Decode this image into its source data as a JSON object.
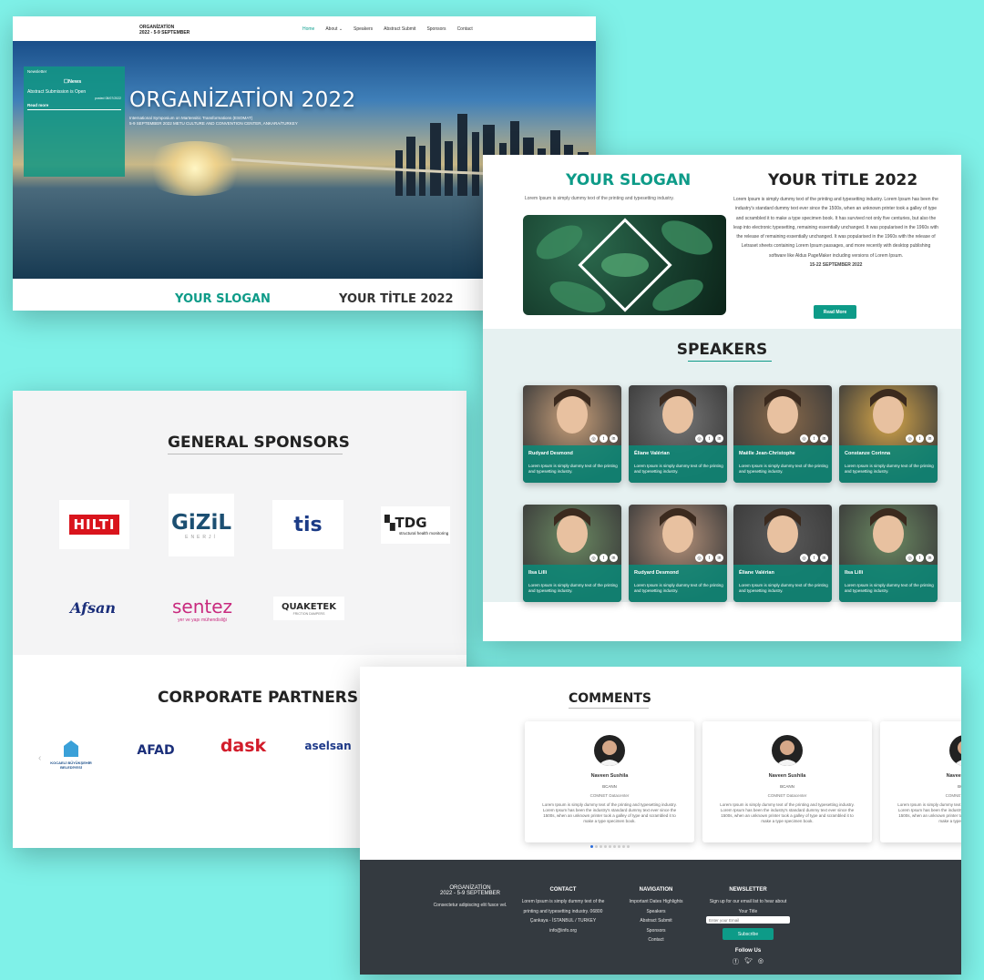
{
  "hero": {
    "brand_line1": "ORGANİZATİON",
    "brand_line2": "2022 - 5-9 SEPTEMBER",
    "nav": [
      "Home",
      "About",
      "Speakers",
      "Abstract Submit",
      "Sponsors",
      "Contact"
    ],
    "news_head": "Newsletter",
    "news_title": "News",
    "news_item": "Abstract Submission is Open",
    "news_date": "posted 08/07/2022",
    "news_more": "Read more",
    "title": "ORGANİZATİON 2022",
    "sub1": "International Symposium on Martensitic Transformations (ESOMAT)",
    "sub2": "5-9 SEPTEMBER 2022 METU CULTURE AND CONVENTION CENTER, ANKARA/TURKEY",
    "band_slogan": "YOUR SLOGAN",
    "band_title": "YOUR TİTLE 2022"
  },
  "about": {
    "slogan": "YOUR SLOGAN",
    "slogan_text": "Lorem Ipsum is simply dummy text of the printing and typesetting industry.",
    "title": "YOUR TİTLE 2022",
    "body": "Lorem Ipsum is simply dummy text of the printing and typesetting industry. Lorem Ipsum has been the industry's standard dummy text ever since the 1500s, when an unknown printer took a galley of type and scrambled it to make a type specimen book. It has survived not only five centuries, but also the leap into electronic typesetting, remaining essentially unchanged. It was popularised in the 1960s with the release of remaining essentially unchanged. It was popularised in the 1960s with the release of Letraset sheets containing Lorem Ipsum passages, and more recently with desktop publishing software like Aldus PageMaker including versions of Lorem Ipsum.",
    "dates": "15-22 SEPTEMBER 2022",
    "read_more": "Read More"
  },
  "speakers": {
    "title": "SPEAKERS",
    "desc": "Lorem Ipsum is simply dummy text of the printing and typesetting industry.",
    "names": [
      "Rudyard Desmond",
      "Éliane Valérian",
      "Maëlle Jean-Christophe",
      "Constanze Corinna",
      "Ilsa Lilli",
      "Rudyard Desmond",
      "Éliane Valérian",
      "Ilsa Lilli"
    ]
  },
  "sponsors": {
    "title": "GENERAL SPONSORS",
    "logos": [
      "HILTI",
      "GiZiL",
      "ENERJİ",
      "tis",
      "TDG",
      "structural health monitoring",
      "Afsan",
      "sentez",
      "yer ve yapı mühendisliği",
      "QUAKETEK",
      "FRICTION DAMPERS"
    ],
    "partners_title": "CORPORATE PARTNERS",
    "partners": [
      "KOCAELİ BÜYÜKŞEHİR BELEDİYESİ",
      "AFAD",
      "dask",
      "aselsan"
    ]
  },
  "comments": {
    "title": "COMMENTS",
    "name": "Naveen Sushila",
    "org": "BCANN",
    "dept": "COMNET Datacenter",
    "text": "Lorem Ipsum is simply dummy text of the printing and typesetting industry. Lorem Ipsum has been the industry's standard dummy text ever since the 1500s, when an unknown printer took a galley of type and scrambled it to make a type specimen book."
  },
  "footer": {
    "brand1": "ORGANİZATİON",
    "brand2": "2022 - 5-9 SEPTEMBER",
    "brand_text": "Consectetur adipiscing elit fusce vel.",
    "contact_h": "CONTACT",
    "contact1": "Lorem Ipsum is simply dummy text of the",
    "contact2": "printing and typesetting industry. 06800",
    "contact3": "Çankaya - İSTANBUL / TURKEY",
    "contact4": "info@info.org",
    "nav_h": "NAVIGATION",
    "nav": [
      "Important Dates Highlights",
      "Speakers",
      "Abstract Submit",
      "Sponsors",
      "Contact"
    ],
    "news_h": "NEWSLETTER",
    "news_text": "Sign up for our email list to hear about",
    "news_text2": "Your Title",
    "email_ph": "Enter your Email",
    "subscribe": "Subscribe",
    "follow": "Follow Us"
  },
  "colors": {
    "accent": "#0d9b88",
    "footer": "#343a40",
    "background": "#7ff1e8"
  }
}
